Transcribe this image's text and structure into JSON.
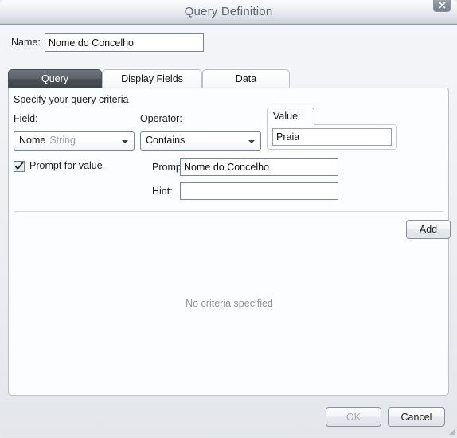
{
  "window": {
    "title": "Query Definition",
    "close_icon": "close-icon"
  },
  "name_row": {
    "label": "Name:",
    "value": "Nome do Concelho",
    "placeholder": ""
  },
  "tabs": [
    {
      "label": "Query",
      "active": true
    },
    {
      "label": "Display Fields",
      "active": false
    },
    {
      "label": "Data",
      "active": false
    }
  ],
  "query_tab": {
    "instruction": "Specify your query criteria",
    "field": {
      "label": "Field:",
      "value": "Nome",
      "type": "String"
    },
    "operator": {
      "label": "Operator:",
      "value": "Contains"
    },
    "value": {
      "label": "Value:",
      "value": "Praia",
      "placeholder": ""
    },
    "add_button": "Add",
    "prompt_checkbox": {
      "label": "Prompt for value.",
      "checked": true
    },
    "prompt": {
      "label": "Prompt:",
      "value": "Nome do Concelho",
      "placeholder": ""
    },
    "hint": {
      "label": "Hint:",
      "value": "",
      "placeholder": ""
    },
    "empty_message": "No criteria specified"
  },
  "footer": {
    "ok_label": "OK",
    "cancel_label": "Cancel"
  },
  "colors": {
    "active_tab": "#4c5158",
    "title_text": "#5c6270",
    "muted_text": "#8e939b",
    "panel_bg": "#fcfdfe",
    "window_bg": "#eceef2"
  }
}
